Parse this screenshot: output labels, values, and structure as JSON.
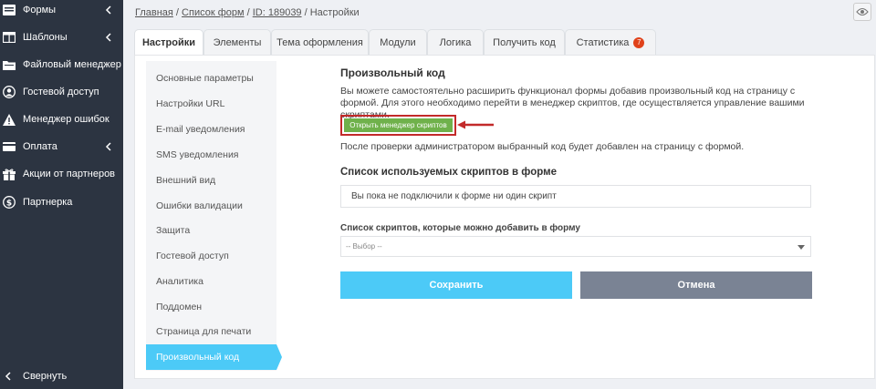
{
  "sidebar": {
    "items": [
      {
        "label": "Формы",
        "icon": "forms-icon",
        "has_chevron": true
      },
      {
        "label": "Шаблоны",
        "icon": "templates-icon",
        "has_chevron": true
      },
      {
        "label": "Файловый менеджер",
        "icon": "folder-icon",
        "has_chevron": false
      },
      {
        "label": "Гостевой доступ",
        "icon": "user-icon",
        "has_chevron": false
      },
      {
        "label": "Менеджер ошибок",
        "icon": "warning-icon",
        "has_chevron": false
      },
      {
        "label": "Оплата",
        "icon": "credit-card-icon",
        "has_chevron": true
      },
      {
        "label": "Акции от партнеров",
        "icon": "gift-icon",
        "has_chevron": false
      },
      {
        "label": "Партнерка",
        "icon": "dollar-icon",
        "has_chevron": false
      }
    ],
    "collapse_label": "Свернуть"
  },
  "breadcrumb": {
    "home": "Главная",
    "forms_list": "Список форм",
    "form_id": "ID: 189039",
    "current": "Настройки",
    "sep": " / "
  },
  "tabs": [
    {
      "label": "Настройки",
      "active": true
    },
    {
      "label": "Элементы",
      "active": false
    },
    {
      "label": "Тема оформления",
      "active": false
    },
    {
      "label": "Модули",
      "active": false
    },
    {
      "label": "Логика",
      "active": false
    },
    {
      "label": "Получить код",
      "active": false
    },
    {
      "label": "Статистика",
      "active": false,
      "badge": "7"
    }
  ],
  "submenu": [
    {
      "label": "Основные параметры",
      "active": false
    },
    {
      "label": "Настройки URL",
      "active": false
    },
    {
      "label": "E-mail уведомления",
      "active": false
    },
    {
      "label": "SMS уведомления",
      "active": false
    },
    {
      "label": "Внешний вид",
      "active": false
    },
    {
      "label": "Ошибки валидации",
      "active": false
    },
    {
      "label": "Защита",
      "active": false
    },
    {
      "label": "Гостевой доступ",
      "active": false
    },
    {
      "label": "Аналитика",
      "active": false
    },
    {
      "label": "Поддомен",
      "active": false
    },
    {
      "label": "Страница для печати",
      "active": false
    },
    {
      "label": "Произвольный код",
      "active": true
    }
  ],
  "content": {
    "title": "Произвольный код",
    "description": "Вы можете самостоятельно расширить функционал формы добавив произвольный код на страницу с формой. Для этого необходимо перейти в менеджер скриптов, где осуществляется управление вашими скриптами.",
    "manager_button": "Открыть менеджер скриптов",
    "after_text": "После проверки администратором выбранный код будет добавлен на страницу с формой.",
    "scripts_title": "Список используемых скриптов в форме",
    "no_scripts": "Вы пока не подключили к форме ни один скрипт",
    "available_title": "Список скриптов, которые можно добавить в форму",
    "select_placeholder": "-- Выбор --",
    "save_label": "Сохранить",
    "cancel_label": "Отмена"
  },
  "colors": {
    "sidebar_bg": "#2c3441",
    "accent": "#4ccaf7",
    "manager_button": "#6fb14b",
    "highlight_border": "#c32a2a",
    "cancel": "#7a8394",
    "badge": "#e0421a"
  }
}
